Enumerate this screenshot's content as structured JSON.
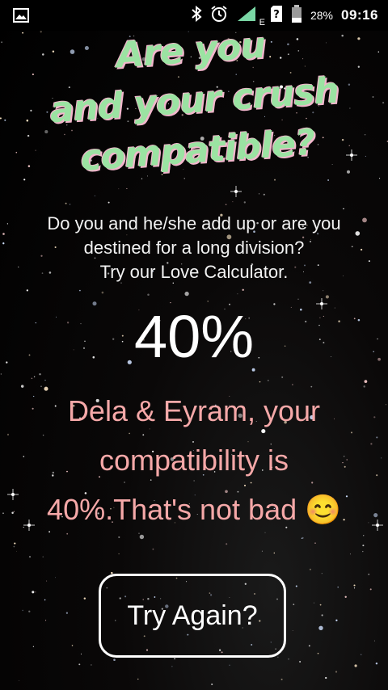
{
  "status_bar": {
    "battery_percent": "28%",
    "time": "09:16",
    "network_type": "E",
    "icons": [
      "image-icon",
      "bluetooth-icon",
      "alarm-icon",
      "signal-icon",
      "sim-unknown-icon",
      "battery-icon"
    ]
  },
  "title": {
    "line1": "Are you",
    "line2": "and your crush",
    "line3": "compatible?",
    "color": "#9be3a2",
    "shadow_color": "#f2b6cc"
  },
  "subtitle": {
    "line1": "Do you and he/she add up or are you",
    "line2": "destined for a long division?",
    "line3": "Try our Love Calculator."
  },
  "score": {
    "value": "40%"
  },
  "result": {
    "line1": "Dela & Eyram, your",
    "line2": "compatibility is",
    "line3": "40%.That's not bad 😊",
    "color": "#f5a8a8"
  },
  "actions": {
    "try_again_label": "Try Again?"
  }
}
